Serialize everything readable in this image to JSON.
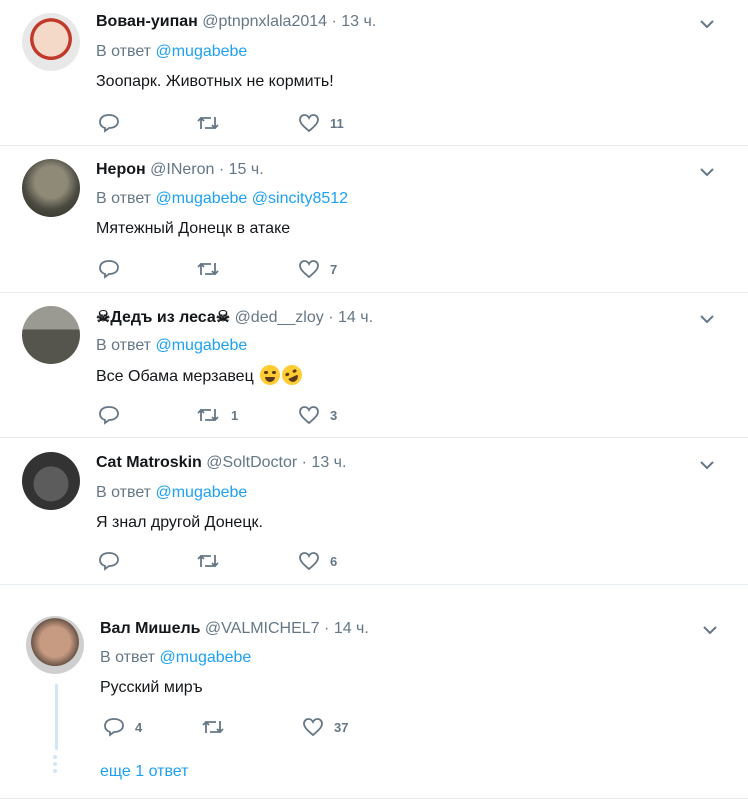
{
  "reply_prefix": "В ответ",
  "more_replies": "еще 1 ответ",
  "colors": {
    "link": "#1da1f2",
    "muted": "#657786",
    "text": "#14171a",
    "divider": "#e6ecf0",
    "thread": "#cfe6f7"
  },
  "tweets": [
    {
      "name": "Вован-уипан",
      "handle": "@ptnpnxlala2014",
      "time": "13 ч.",
      "mentions": [
        "@mugabebe"
      ],
      "text": "Зоопарк. Животных не кормить!",
      "replies": "",
      "retweets": "",
      "likes": "11"
    },
    {
      "name": "Нерон",
      "handle": "@INeron",
      "time": "15 ч.",
      "mentions": [
        "@mugabebe",
        "@sincity8512"
      ],
      "text": "Мятежный Донецк в атаке",
      "replies": "",
      "retweets": "",
      "likes": "7"
    },
    {
      "name": "Дедъ из леса",
      "handle": "@ded__zloy",
      "time": "14 ч.",
      "mentions": [
        "@mugabebe"
      ],
      "text": "Все Обама мерзавец",
      "emoji": [
        "face-with-tears-of-joy",
        "rolling-on-the-floor-laughing"
      ],
      "replies": "",
      "retweets": "1",
      "likes": "3"
    },
    {
      "name": "Cat Matroskin",
      "handle": "@SoltDoctor",
      "time": "13 ч.",
      "mentions": [
        "@mugabebe"
      ],
      "text": "Я знал другой Донецк.",
      "replies": "",
      "retweets": "",
      "likes": "6"
    },
    {
      "name": "Вал Мишель",
      "handle": "@VALMICHEL7",
      "time": "14 ч.",
      "mentions": [
        "@mugabebe"
      ],
      "text": "Русский миръ",
      "replies": "4",
      "retweets": "",
      "likes": "37"
    }
  ]
}
